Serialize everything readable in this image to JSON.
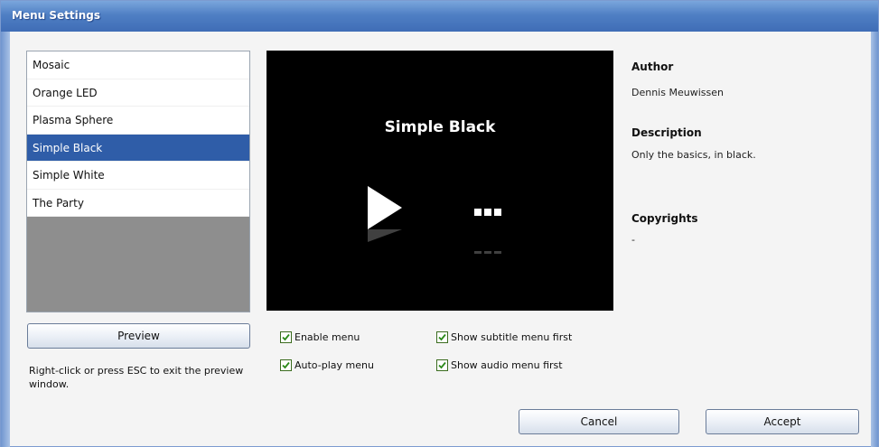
{
  "window": {
    "title": "Menu Settings"
  },
  "menu_list": {
    "items": [
      "Mosaic",
      "Orange LED",
      "Plasma Sphere",
      "Simple Black",
      "Simple White",
      "The Party"
    ],
    "selected_index": 3
  },
  "preview_pane": {
    "title": "Simple Black"
  },
  "info": {
    "author_heading": "Author",
    "author_value": "Dennis Meuwissen",
    "description_heading": "Description",
    "description_value": "Only the basics, in black.",
    "copyrights_heading": "Copyrights",
    "copyrights_value": "-"
  },
  "preview_button": {
    "label": "Preview"
  },
  "hint": {
    "text": "Right-click or press ESC to exit the preview window."
  },
  "options": {
    "enable_menu": {
      "label": "Enable menu",
      "checked": true
    },
    "auto_play_menu": {
      "label": "Auto-play menu",
      "checked": true
    },
    "show_subtitle_menu_first": {
      "label": "Show subtitle menu first",
      "checked": true
    },
    "show_audio_menu_first": {
      "label": "Show audio menu first",
      "checked": true
    }
  },
  "buttons": {
    "cancel": "Cancel",
    "accept": "Accept"
  },
  "colors": {
    "selection": "#2f5da8",
    "titlebar": "#4f7fc4",
    "checkmark": "#2b8a1a"
  }
}
